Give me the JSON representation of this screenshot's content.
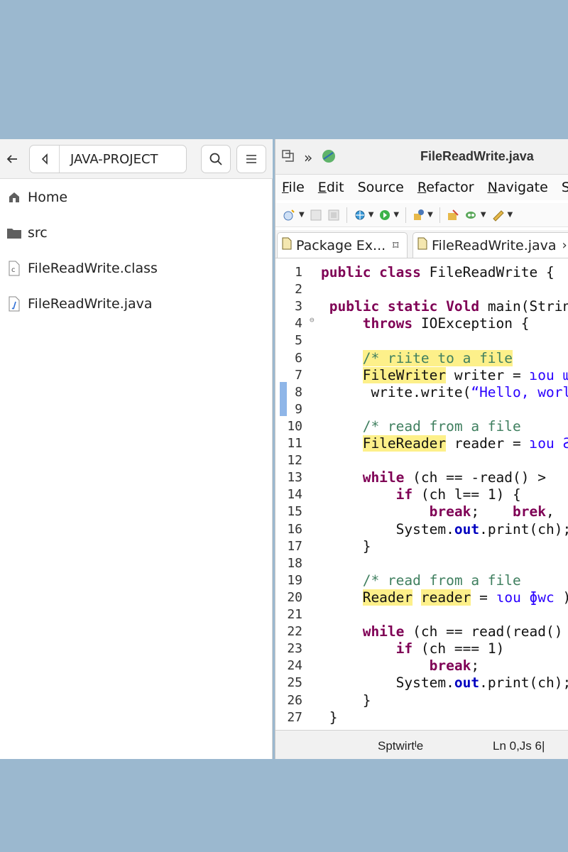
{
  "file_manager": {
    "path_label": "JAVA-PROJECT",
    "items": [
      {
        "label": "Home",
        "icon": "home-icon"
      },
      {
        "label": "src",
        "icon": "folder-icon"
      },
      {
        "label": "FileReadWrite.class",
        "icon": "class-file-icon"
      },
      {
        "label": "FileReadWrite.java",
        "icon": "java-file-icon"
      }
    ]
  },
  "ide": {
    "window_title": "FileReadWrite.java",
    "menu": [
      "File",
      "Edit",
      "Source",
      "Refactor",
      "Navigate",
      "Se"
    ],
    "tabs": [
      {
        "label": "Package Ex...",
        "close": "⌑"
      },
      {
        "label": "FileReadWrite.java",
        "close": "›"
      }
    ],
    "code_lines": [
      {
        "n": "1",
        "parts": [
          [
            "kw",
            "public class "
          ],
          [
            "",
            "FileReadWrite {"
          ]
        ]
      },
      {
        "n": "2",
        "parts": []
      },
      {
        "n": "3",
        "parts": [
          [
            "kw",
            " public static "
          ],
          [
            "kw",
            "Vold "
          ],
          [
            "",
            "main(Strin"
          ]
        ]
      },
      {
        "n": "4",
        "parts": [
          [
            "",
            "     "
          ],
          [
            "kw",
            "throws "
          ],
          [
            "",
            "IOException {"
          ]
        ]
      },
      {
        "n": "5",
        "parts": []
      },
      {
        "n": "6",
        "parts": [
          [
            "",
            "     "
          ],
          [
            "cm hl",
            "/* riite to a file"
          ]
        ]
      },
      {
        "n": "7",
        "parts": [
          [
            "",
            "     "
          ],
          [
            "hl",
            "FileWriter"
          ],
          [
            "",
            " writer = "
          ],
          [
            "str",
            "ɿou ɰɯ"
          ]
        ]
      },
      {
        "n": "8",
        "parts": [
          [
            "",
            "      write.write("
          ],
          [
            "str",
            "“Hello, worl"
          ]
        ]
      },
      {
        "n": "9",
        "parts": []
      },
      {
        "n": "10",
        "parts": [
          [
            "",
            "     "
          ],
          [
            "cm",
            "/* read from a file"
          ]
        ]
      },
      {
        "n": "11",
        "parts": [
          [
            "",
            "     "
          ],
          [
            "hl",
            "FileReader"
          ],
          [
            "",
            " reader = "
          ],
          [
            "str",
            "ɿou Ƨı"
          ]
        ]
      },
      {
        "n": "12",
        "parts": []
      },
      {
        "n": "13",
        "parts": [
          [
            "",
            "     "
          ],
          [
            "kw",
            "while "
          ],
          [
            "",
            "(ch == -read() >"
          ]
        ]
      },
      {
        "n": "14",
        "parts": [
          [
            "",
            "         "
          ],
          [
            "kw",
            "if "
          ],
          [
            "",
            "(ch l== 1) {"
          ]
        ]
      },
      {
        "n": "15",
        "parts": [
          [
            "",
            "             "
          ],
          [
            "kw",
            "break"
          ],
          [
            "",
            ";    "
          ],
          [
            "kw",
            "brek"
          ],
          [
            "",
            "‚"
          ]
        ]
      },
      {
        "n": "16",
        "parts": [
          [
            "",
            "         System."
          ],
          [
            "fld",
            "out"
          ],
          [
            "",
            ".print(ch);"
          ]
        ]
      },
      {
        "n": "17",
        "parts": [
          [
            "",
            "     }"
          ]
        ]
      },
      {
        "n": "18",
        "parts": []
      },
      {
        "n": "19",
        "parts": [
          [
            "",
            "     "
          ],
          [
            "cm",
            "/* read from a file"
          ]
        ]
      },
      {
        "n": "20",
        "parts": [
          [
            "",
            "     "
          ],
          [
            "hl",
            "Reader"
          ],
          [
            "",
            " "
          ],
          [
            "hl",
            "reader"
          ],
          [
            "",
            " = "
          ],
          [
            "str",
            "ɩou ɸwc "
          ],
          [
            "",
            ");"
          ]
        ]
      },
      {
        "n": "21",
        "parts": []
      },
      {
        "n": "22",
        "parts": [
          [
            "",
            "     "
          ],
          [
            "kw",
            "while "
          ],
          [
            "",
            "(ch == read(read()"
          ]
        ]
      },
      {
        "n": "23",
        "parts": [
          [
            "",
            "         "
          ],
          [
            "kw",
            "if "
          ],
          [
            "",
            "(ch === 1)"
          ]
        ]
      },
      {
        "n": "24",
        "parts": [
          [
            "",
            "             "
          ],
          [
            "kw",
            "break"
          ],
          [
            "",
            ";"
          ]
        ]
      },
      {
        "n": "25",
        "parts": [
          [
            "",
            "         System."
          ],
          [
            "fld",
            "out"
          ],
          [
            "",
            ".print(ch);"
          ]
        ]
      },
      {
        "n": "26",
        "parts": [
          [
            "",
            "     }"
          ]
        ]
      },
      {
        "n": "27",
        "parts": [
          [
            "",
            " }"
          ]
        ]
      }
    ],
    "status_left": "Sptwirtᴵe",
    "status_right": "Ln 0,Js 6|"
  }
}
